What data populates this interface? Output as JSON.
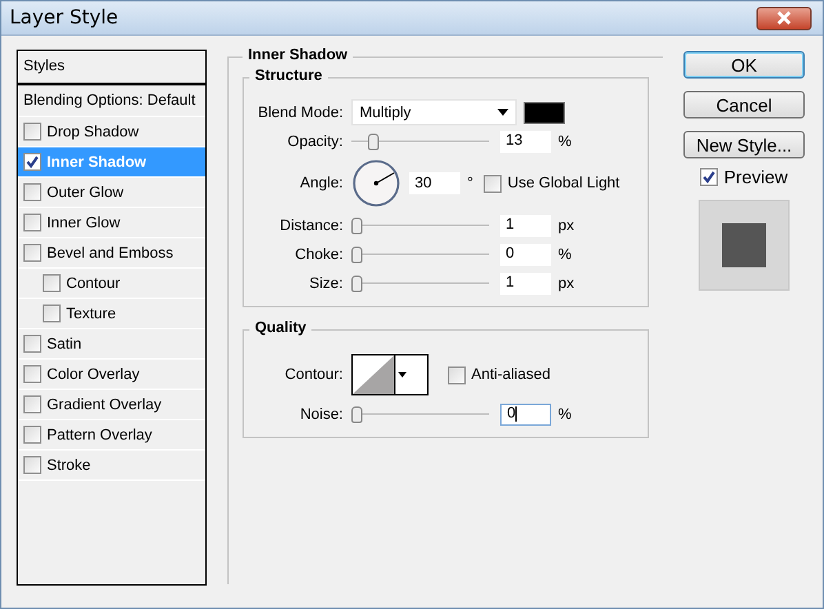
{
  "window": {
    "title": "Layer Style"
  },
  "styles_panel": {
    "header": "Styles",
    "blending_options": "Blending Options: Default",
    "items": [
      {
        "label": "Drop Shadow",
        "checked": false,
        "selected": false
      },
      {
        "label": "Inner Shadow",
        "checked": true,
        "selected": true
      },
      {
        "label": "Outer Glow",
        "checked": false,
        "selected": false
      },
      {
        "label": "Inner Glow",
        "checked": false,
        "selected": false
      },
      {
        "label": "Bevel and Emboss",
        "checked": false,
        "selected": false,
        "children": [
          {
            "label": "Contour",
            "checked": false,
            "selected": false
          },
          {
            "label": "Texture",
            "checked": false,
            "selected": false
          }
        ]
      },
      {
        "label": "Satin",
        "checked": false,
        "selected": false
      },
      {
        "label": "Color Overlay",
        "checked": false,
        "selected": false
      },
      {
        "label": "Gradient Overlay",
        "checked": false,
        "selected": false
      },
      {
        "label": "Pattern Overlay",
        "checked": false,
        "selected": false
      },
      {
        "label": "Stroke",
        "checked": false,
        "selected": false
      }
    ]
  },
  "inner_shadow": {
    "title": "Inner Shadow",
    "structure": {
      "title": "Structure",
      "blend_mode": {
        "label": "Blend Mode:",
        "value": "Multiply"
      },
      "rows": [
        {
          "kind": "slider",
          "label": "Opacity:",
          "level": 0.13,
          "value": "13",
          "unit": "%"
        },
        {
          "kind": "angle",
          "label": "Angle:",
          "value": "30",
          "unit": "°",
          "checkbox_label": "Use Global Light",
          "checked": false
        },
        {
          "kind": "slider",
          "label": "Distance:",
          "level": 0.0,
          "value": "1",
          "unit": "px"
        },
        {
          "kind": "slider",
          "label": "Choke:",
          "level": 0.0,
          "value": "0",
          "unit": "%"
        },
        {
          "kind": "slider",
          "label": "Size:",
          "level": 0.0,
          "value": "1",
          "unit": "px"
        }
      ]
    },
    "quality": {
      "title": "Quality",
      "contour_label": "Contour:",
      "anti_aliased": {
        "label": "Anti-aliased",
        "checked": false
      },
      "noise": {
        "label": "Noise:",
        "level": 0.0,
        "value": "0",
        "unit": "%"
      }
    }
  },
  "buttons": [
    {
      "label": "OK",
      "default": true
    },
    {
      "label": "Cancel",
      "default": false
    },
    {
      "label": "New Style...",
      "default": false
    }
  ],
  "preview": {
    "label": "Preview",
    "checked": true
  }
}
